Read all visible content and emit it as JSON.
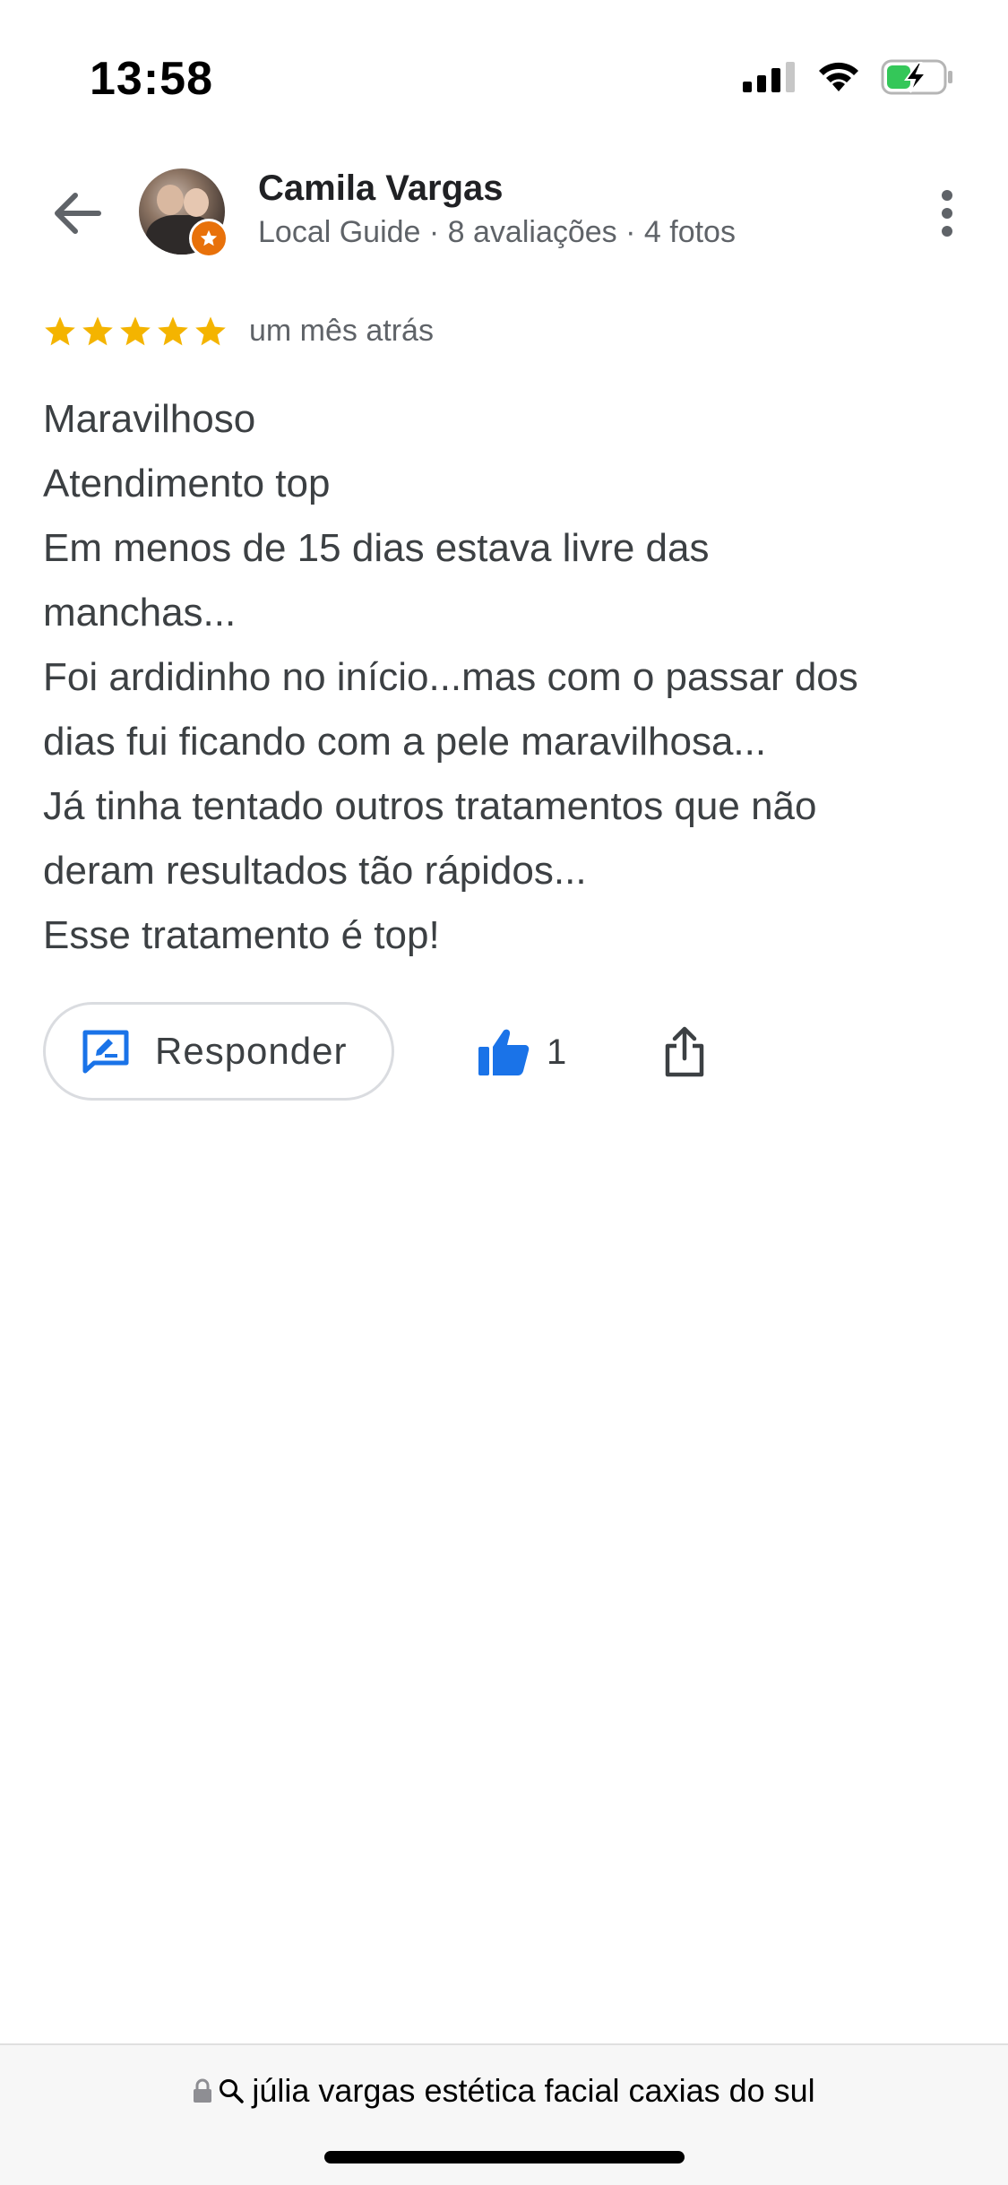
{
  "status_bar": {
    "time": "13:58"
  },
  "header": {
    "reviewer_name": "Camila Vargas",
    "reviewer_meta": "Local Guide · 8 avaliações · 4 fotos"
  },
  "review": {
    "rating": 5,
    "rating_max": 5,
    "date": "um mês atrás",
    "lines": [
      "Maravilhoso",
      "Atendimento top",
      "Em menos de 15 dias estava livre das",
      "manchas...",
      "Foi ardidinho no início...mas com o passar dos",
      "dias fui ficando com a pele maravilhosa...",
      "Já tinha tentado outros tratamentos que não",
      "deram resultados tão rápidos...",
      "Esse tratamento é top!"
    ]
  },
  "actions": {
    "reply_label": "Responder",
    "like_count": "1"
  },
  "browser": {
    "url": "júlia vargas estética facial caxias do sul"
  },
  "colors": {
    "star": "#f4b400",
    "accent_blue": "#1a73e8",
    "guide_badge": "#e8710a",
    "battery_green": "#34c759"
  },
  "icons": {
    "back": "arrow-left-icon",
    "more": "more-vert-icon",
    "reply": "rate-review-icon",
    "like": "thumb-up-icon",
    "share": "share-icon",
    "lock": "lock-icon",
    "search": "search-icon"
  }
}
